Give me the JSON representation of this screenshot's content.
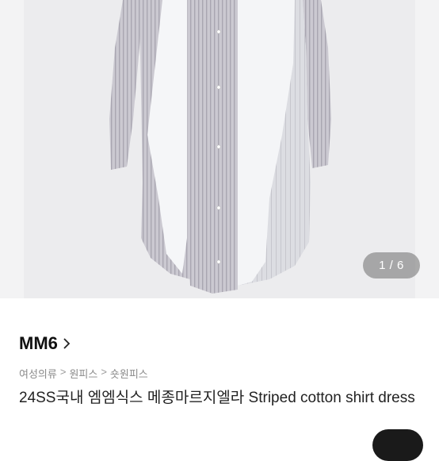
{
  "gallery": {
    "counter": "1 / 6"
  },
  "product": {
    "brand": "MM6",
    "breadcrumb": [
      "여성의류",
      "원피스",
      "숏원피스"
    ],
    "title": "24SS국내 엠엠식스 메종마르지엘라 Striped cotton shirt dress"
  },
  "icons": {
    "brand_link": "chevron-right-icon"
  },
  "colors": {
    "background": "#f3f3f4",
    "counter_bg": "#6e6e6e",
    "fab": "#1a1a1a"
  }
}
